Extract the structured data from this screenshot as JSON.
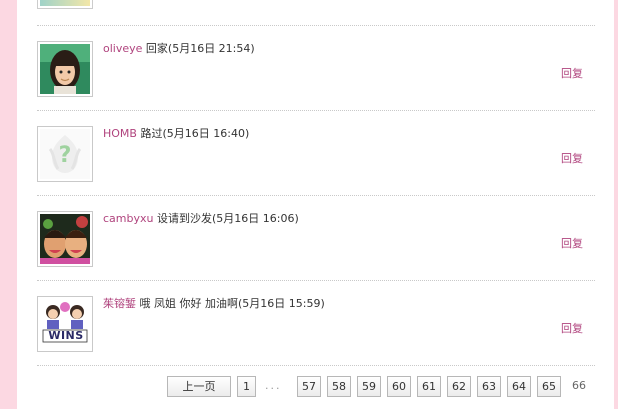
{
  "comments": [
    {
      "user": "oliveye",
      "text": " 回家(5月16日  21:54)",
      "reply": "回复"
    },
    {
      "user": "HOMB",
      "text": " 路过(5月16日  16:40)",
      "reply": "回复"
    },
    {
      "user": "cambyxu",
      "text": " 设请到沙发(5月16日  16:06)",
      "reply": "回复"
    },
    {
      "user": "茱镕錾",
      "text": " 哦  凤姐  你好  加油啊(5月16日  15:59)",
      "reply": "回复"
    }
  ],
  "pager": {
    "prev": "上一页",
    "first": "1",
    "ellipsis": "...",
    "pages": [
      "57",
      "58",
      "59",
      "60",
      "61",
      "62",
      "63",
      "64",
      "65"
    ],
    "current": "66"
  }
}
